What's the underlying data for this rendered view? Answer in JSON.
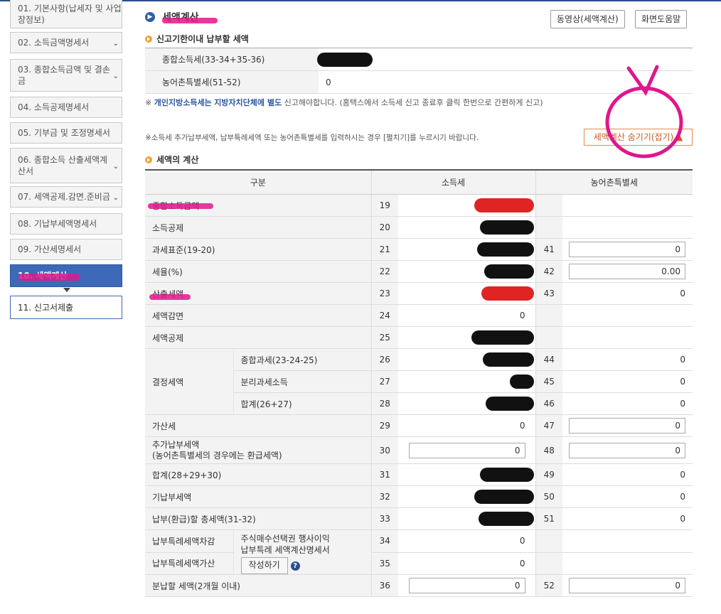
{
  "sidebar": {
    "items": [
      {
        "label": "01. 기본사항(납세자 및 사업장정보)",
        "chevron": false
      },
      {
        "label": "02. 소득금액명세서",
        "chevron": true
      },
      {
        "label": "03. 종합소득금액 및 결손금",
        "chevron": true
      },
      {
        "label": "04. 소득공제명세서",
        "chevron": false
      },
      {
        "label": "05. 기부금 및 조정명세서",
        "chevron": false
      },
      {
        "label": "06. 종합소득 산출세액계산서",
        "chevron": true
      },
      {
        "label": "07. 세액공제.감면.준비금",
        "chevron": true
      },
      {
        "label": "08. 기납부세액명세서",
        "chevron": false
      },
      {
        "label": "09. 가산세명세서",
        "chevron": false
      },
      {
        "label": "10. 세액계산",
        "chevron": false,
        "active": true
      },
      {
        "label": "11. 신고서제출",
        "chevron": false,
        "next": true
      }
    ]
  },
  "header": {
    "title": "세액계산",
    "video_button": "동영상(세액계산)",
    "help_button": "화면도움말"
  },
  "deadline_section": {
    "title": "신고기한이내 납부할 세액",
    "rows": [
      {
        "label": "종합소득세(33-34+35-36)",
        "value": ""
      },
      {
        "label": "농어촌특별세(51-52)",
        "value": "0"
      }
    ]
  },
  "notes": {
    "local_tax_prefix": "※",
    "local_tax_bold": "개인지방소득세는",
    "local_tax_blue": "지방자치단체에 별도",
    "local_tax_rest": "신고해야합니다. (홈택스에서 소득세 신고 종료후 클릭 한번으로 간편하게 신고)",
    "extra_tax": "※소득세 추가납부세액, 납부특례세액 또는 농어촌특별세를 입력하시는 경우 [펼치기]를 누르시기 바랍니다."
  },
  "toggle_button": "세액계산 숨기기(접기) ▲",
  "calc_section": {
    "title": "세액의 계산",
    "headers": {
      "category": "구분",
      "income_tax": "소득세",
      "rural_tax": "농어촌특별세"
    },
    "rows": [
      {
        "label": "종합소득금액",
        "no": "19",
        "val": "",
        "no2": "",
        "val2": ""
      },
      {
        "label": "소득공제",
        "no": "20",
        "val": "",
        "no2": "",
        "val2": ""
      },
      {
        "label": "과세표준(19-20)",
        "no": "21",
        "val": "",
        "no2": "41",
        "val2": "0"
      },
      {
        "label": "세율(%)",
        "no": "22",
        "val": "",
        "no2": "42",
        "val2": "0.00"
      },
      {
        "label": "산출세액",
        "no": "23",
        "val": "",
        "no2": "43",
        "val2": "0"
      },
      {
        "label": "세액감면",
        "no": "24",
        "val": "0",
        "no2": "",
        "val2": ""
      },
      {
        "label": "세액공제",
        "no": "25",
        "val": "",
        "no2": "",
        "val2": ""
      },
      {
        "group": "결정세액",
        "sub": "종합과세(23-24-25)",
        "no": "26",
        "val": "",
        "no2": "44",
        "val2": "0"
      },
      {
        "sub": "분리과세소득",
        "no": "27",
        "val": "",
        "no2": "45",
        "val2": "0"
      },
      {
        "sub": "합계(26+27)",
        "no": "28",
        "val": "",
        "no2": "46",
        "val2": "0"
      },
      {
        "label": "가산세",
        "no": "29",
        "val": "0",
        "no2": "47",
        "val2": "0"
      },
      {
        "label": "추가납부세액",
        "label2": "(농어촌특별세의 경우에는 환급세액)",
        "no": "30",
        "val": "0",
        "no2": "48",
        "val2": "0"
      },
      {
        "label": "합계(28+29+30)",
        "no": "31",
        "val": "",
        "no2": "49",
        "val2": "0"
      },
      {
        "label": "기납부세액",
        "no": "32",
        "val": "",
        "no2": "50",
        "val2": "0"
      },
      {
        "label": "납부(환급)할 총세액(31-32)",
        "no": "33",
        "val": "",
        "no2": "51",
        "val2": "0"
      },
      {
        "label": "납부특례세액차감",
        "no": "34",
        "val": "0",
        "no2": "",
        "val2": ""
      },
      {
        "label": "납부특례세액가산",
        "no": "35",
        "val": "0",
        "no2": "",
        "val2": ""
      },
      {
        "label": "분납할 세액(2개월 이내)",
        "no": "36",
        "val": "0",
        "no2": "52",
        "val2": "0"
      }
    ],
    "special_label_1": "주식매수선택권 행사이익",
    "special_label_2": "납부특례 세액계산명세서",
    "write_button": "작성하기",
    "help_icon": "?"
  }
}
